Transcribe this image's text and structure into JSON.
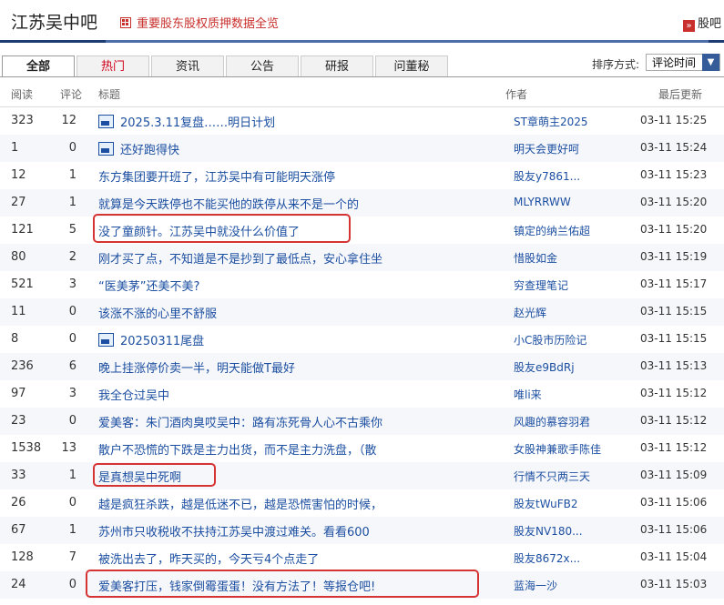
{
  "header": {
    "title": "江苏吴中吧",
    "notice": "重要股东股权质押数据全览",
    "right_link": "股吧"
  },
  "tabs": [
    "全部",
    "热门",
    "资讯",
    "公告",
    "研报",
    "问董秘"
  ],
  "sort": {
    "label": "排序方式:",
    "selected": "评论时间"
  },
  "columns": {
    "read": "阅读",
    "comment": "评论",
    "title": "标题",
    "author": "作者",
    "updated": "最后更新"
  },
  "rows": [
    {
      "read": "323",
      "comment": "12",
      "title": "2025.3.11复盘……明日计划",
      "author": "ST章萌主2025",
      "time": "03-11 15:25",
      "has_image": true
    },
    {
      "read": "1",
      "comment": "0",
      "title": "还好跑得快",
      "author": "明天会更好呵",
      "time": "03-11 15:24",
      "has_image": true
    },
    {
      "read": "12",
      "comment": "1",
      "title": "东方集团要开班了，江苏吴中有可能明天涨停",
      "author": "股友y7861...",
      "time": "03-11 15:23",
      "has_image": false
    },
    {
      "read": "27",
      "comment": "1",
      "title": "就算是今天跌停也不能买他的跌停从来不是一个的",
      "author": "MLYRRWW",
      "time": "03-11 15:20",
      "has_image": false
    },
    {
      "read": "121",
      "comment": "5",
      "title": "没了童颜针。江苏吴中就没什么价值了",
      "author": "镇定的纳兰佑超",
      "time": "03-11 15:20",
      "has_image": false
    },
    {
      "read": "80",
      "comment": "2",
      "title": "刚才买了点，不知道是不是抄到了最低点，安心拿住坐",
      "author": "惜股如金",
      "time": "03-11 15:19",
      "has_image": false
    },
    {
      "read": "521",
      "comment": "3",
      "title": "“医美茅”还美不美?",
      "author": "穷查理笔记",
      "time": "03-11 15:17",
      "has_image": false
    },
    {
      "read": "11",
      "comment": "0",
      "title": "该涨不涨的心里不舒服",
      "author": "赵光辉",
      "time": "03-11 15:15",
      "has_image": false
    },
    {
      "read": "8",
      "comment": "0",
      "title": "20250311尾盘",
      "author": "小C股市历险记",
      "time": "03-11 15:15",
      "has_image": true
    },
    {
      "read": "236",
      "comment": "6",
      "title": "晚上挂涨停价卖一半，明天能做T最好",
      "author": "股友e9BdRj",
      "time": "03-11 15:13",
      "has_image": false
    },
    {
      "read": "97",
      "comment": "3",
      "title": "我全仓过吴中",
      "author": "唯li来",
      "time": "03-11 15:12",
      "has_image": false
    },
    {
      "read": "23",
      "comment": "0",
      "title": "爱美客：朱门酒肉臭哎吴中：路有冻死骨人心不古乘你",
      "author": "风趣的慕容羽君",
      "time": "03-11 15:12",
      "has_image": false
    },
    {
      "read": "1538",
      "comment": "13",
      "title": "散户不恐慌的下跌是主力出货，而不是主力洗盘，（散",
      "author": "女股神兼歌手陈佳",
      "time": "03-11 15:12",
      "has_image": false
    },
    {
      "read": "33",
      "comment": "1",
      "title": "是真想吴中死啊",
      "author": "行情不只两三天",
      "time": "03-11 15:09",
      "has_image": false
    },
    {
      "read": "26",
      "comment": "0",
      "title": "越是疯狂杀跌，越是低迷不已，越是恐慌害怕的时候，",
      "author": "股友tWuFB2",
      "time": "03-11 15:06",
      "has_image": false
    },
    {
      "read": "67",
      "comment": "1",
      "title": "苏州市只收税收不扶持江苏吴中渡过难关。看看600",
      "author": "股友NV180...",
      "time": "03-11 15:06",
      "has_image": false
    },
    {
      "read": "128",
      "comment": "7",
      "title": "被洗出去了，昨天买的，今天亏4个点走了",
      "author": "股友8672x...",
      "time": "03-11 15:04",
      "has_image": false
    },
    {
      "read": "24",
      "comment": "0",
      "title": "爱美客打压，钱家倒霉蛋蛋！没有方法了！等报仓吧!",
      "author": "蓝海一沙",
      "time": "03-11 15:03",
      "has_image": false
    }
  ]
}
